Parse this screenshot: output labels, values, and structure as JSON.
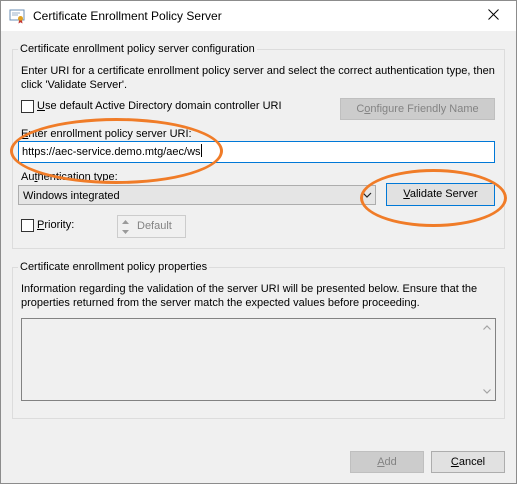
{
  "window": {
    "title": "Certificate Enrollment Policy Server",
    "icon": "certificate-icon",
    "close_icon": "close-icon"
  },
  "config_group": {
    "legend": "Certificate enrollment policy server configuration",
    "description": "Enter URI for a certificate enrollment policy server and select the correct authentication type, then click 'Validate Server'.",
    "use_default_checkbox": {
      "label_access_key": "U",
      "label_rest": "se default Active Directory domain controller URI",
      "checked": false
    },
    "configure_friendly_name_button": {
      "label_prefix": "C",
      "label_access_key": "o",
      "label_rest": "nfigure Friendly Name",
      "enabled": false
    },
    "uri_label": {
      "label_access_key": "E",
      "label_rest": "nter enrollment policy server URI:"
    },
    "uri_value": "https://aec-service.demo.mtg/aec/ws",
    "auth_label": {
      "label_prefix": "Au",
      "label_access_key": "t",
      "label_rest": "hentication type:"
    },
    "auth_selected": "Windows integrated",
    "validate_button": {
      "label_access_key": "V",
      "label_rest": "alidate Server"
    },
    "priority_checkbox": {
      "label_access_key": "P",
      "label_rest": "riority:",
      "checked": false
    },
    "priority_value": "Default"
  },
  "properties_group": {
    "legend": "Certificate enrollment policy properties",
    "description": "Information regarding the validation of the server URI will be presented below. Ensure that the properties returned from the server match the expected values before proceeding.",
    "content": ""
  },
  "footer": {
    "add_button": {
      "label_access_key": "A",
      "label_rest": "dd",
      "enabled": false
    },
    "cancel_button": {
      "label_access_key": "C",
      "label_rest": "ancel"
    }
  },
  "colors": {
    "annotation": "#f07c28",
    "focus": "#0078d7",
    "dialog_background": "#f0f0f0"
  }
}
